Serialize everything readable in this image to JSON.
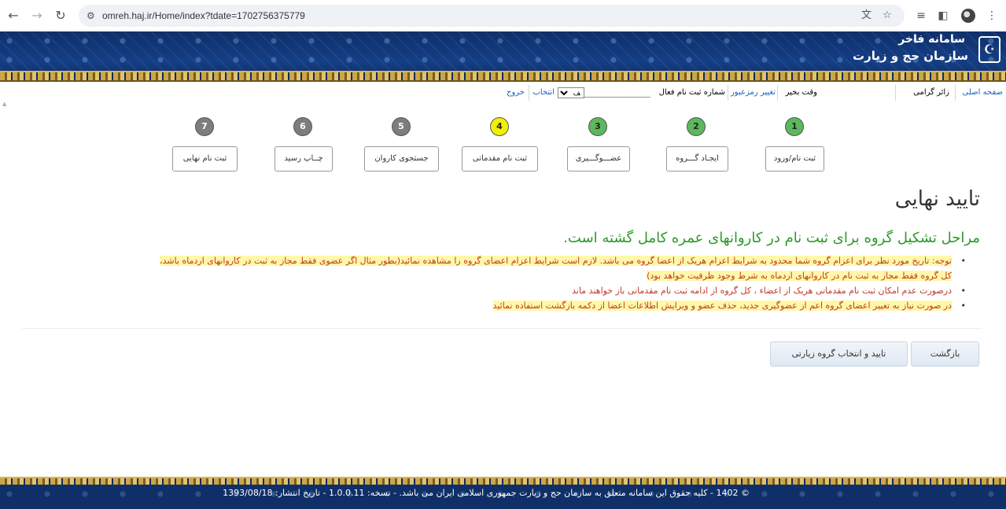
{
  "browser": {
    "url": "omreh.haj.ir/Home/index?tdate=1702756375779"
  },
  "banner": {
    "title": "سامانه فاخر",
    "subtitle": "سازمان حج و زیارت"
  },
  "infobar": {
    "home": "صفحه اصلی",
    "pilgrim": "زائر گرامی",
    "greeting": "وقت بخیر",
    "change_password": "تغییر رمزعبور",
    "active_reg_label": "شماره ثبت نام فعال",
    "select_value": "ﻒ",
    "choose": "انتخاب",
    "logout": "خروج"
  },
  "steps": [
    {
      "num": "1",
      "label": "ثبت نام/ورود",
      "status": "done"
    },
    {
      "num": "2",
      "label": "ایجـاد گـــروه",
      "status": "done"
    },
    {
      "num": "3",
      "label": "عضـــوگـــیری",
      "status": "done"
    },
    {
      "num": "4",
      "label": "ثبت نام مقدماتی",
      "status": "current"
    },
    {
      "num": "5",
      "label": "جستجوی کاروان",
      "status": "todo"
    },
    {
      "num": "6",
      "label": "چــاپ رسید",
      "status": "todo"
    },
    {
      "num": "7",
      "label": "ثبت نام نهایی",
      "status": "todo"
    }
  ],
  "main": {
    "title": "تایید نهایی",
    "subtitle": "مراحل تشکیل گروه برای ثبت نام در کاروانهای عمره کامل گشته است.",
    "notes": [
      "توجه: تاریخ مورد نظر برای اعزام گروه شما محدود به شرایط اعزام هریک از اعضا گروه می باشد. لازم است شرایط اعزام اعضای گروه را مشاهده نمائید(بطور مثال اگر عضوی فقط مجاز به ثبت در کاروانهای اردماه باشد،",
      "کل گروه فقط مجاز به ثبت نام در کاروانهای اردماه به شرط وجود ظرفیت خواهد بود)",
      "درصورت عدم امکان ثبت نام مقدماتی هریک از اعضاء ، کل گروه از ادامه ثبت نام مقدماتی باز خواهند ماند",
      "در صورت نیاز به تغییر اعضای گروه اعم از عضوگیری جدید، حذف عضو و ویرایش اطلاعات اعضا از دکمه بازگشت استفاده نمائید"
    ],
    "back_button": "بازگشت",
    "confirm_button": "تایید و انتخاب گروه زیارتی"
  },
  "footer": {
    "text": "© 1402 - کلیه حقوق این سامانه متعلق به سازمان حج و زیارت جمهوری اسلامی ایران می باشد. - نسخه: 1.0.0.11 - تاریخ انتشار: 1393/08/18"
  },
  "colors": {
    "step_done": "#5cb85c",
    "step_current": "#f0f000",
    "step_todo": "#7d7d7d",
    "subtitle": "#2a9a2a",
    "note_text": "#c0392b",
    "highlight": "#fff8a8",
    "banner": "#143e85"
  }
}
